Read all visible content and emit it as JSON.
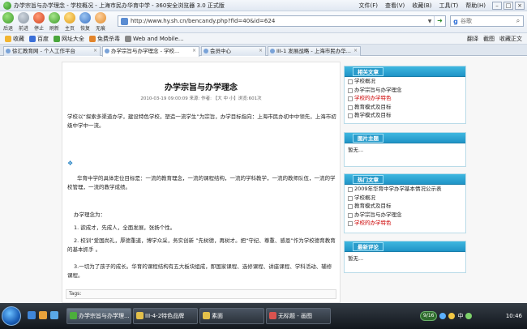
{
  "window": {
    "title": "办学宗旨与办学理念 - 学校概况 - 上海市民办华育中学 - 360安全浏览器 3.0 正式版",
    "menu": [
      "文件(F)",
      "查看(V)",
      "收藏(B)",
      "工具(T)",
      "帮助(H)"
    ]
  },
  "toolbar": {
    "buttons": [
      "后退",
      "前进",
      "停止",
      "刷新",
      "主页",
      "恢复",
      "无痕"
    ],
    "address": "http://www.hy.sh.cn/bencandy.php?fid=40&id=624",
    "search_placeholder": "谷歌"
  },
  "favorites": {
    "items": [
      "收藏",
      "百度",
      "网址大全",
      "免费杀毒",
      "Web and Mobile..."
    ],
    "right_items": [
      "翻译",
      "截图",
      "收藏正文"
    ]
  },
  "tabs": [
    {
      "label": "徐汇教育网 - 个人工作平台"
    },
    {
      "label": "办学宗旨与办学理念 - 学校..."
    },
    {
      "label": "会员中心"
    },
    {
      "label": "III-1 发展战略 - 上海市民办华..."
    }
  ],
  "article": {
    "title": "办学宗旨与办学理念",
    "meta": "2010-03-19 09:00:09 来源: 作者: 【大 中 小】浏览:601次",
    "para1": "学校以“探索多渠道办学，建设特色学校，塑造一流学生”为宗旨，办学目标指向：上海市民办初中中领先，上海市初级中学中一流。",
    "para2": "华育中学的具体定位目标是：一流的教育理念，一流的课程结构，一流的学科教学，一流的教师队伍，一流的学校管理，一流的教学成绩。",
    "para3_title": "办学理念为：",
    "p3_1": "1. 欲成才，先成人，全面发展，张扬个性。",
    "p3_2": "2. 校训“爱国尚礼，厚德重道，博学众采，务实创新 ”先树德，再树才。把“守纪、尊重、感恩”作为学校德育教育的基本抓手 。",
    "p3_3": "3.一切为了孩子的成长。华育的课程结构有五大板块组成，即国家课程、选修课程、讲座课程、学科活动、辅修课程。",
    "tags": "Tags:"
  },
  "sidebar": {
    "related": {
      "title": "相关文章",
      "items": [
        {
          "label": "学校概况",
          "red": false
        },
        {
          "label": "办学宗旨与办学理念",
          "red": false
        },
        {
          "label": "学校的办学特色",
          "red": true
        },
        {
          "label": "教育模式及目标",
          "red": false
        },
        {
          "label": "教学模式及目标",
          "red": false
        }
      ]
    },
    "images": {
      "title": "图片主题",
      "text": "暂无..."
    },
    "hot": {
      "title": "热门文章",
      "items": [
        {
          "label": "2009年华育中学办学基本情况公示表",
          "red": false
        },
        {
          "label": "学校概况",
          "red": false
        },
        {
          "label": "教育模式及目标",
          "red": false
        },
        {
          "label": "办学宗旨与办学理念",
          "red": false
        },
        {
          "label": "学校的办学特色",
          "red": true
        }
      ]
    },
    "comments": {
      "title": "最新评论",
      "text": "暂无..."
    }
  },
  "taskbar": {
    "tasks": [
      "办学宗旨与办学理...",
      "III-4-2特色品牌",
      "素面",
      "无标题 - 画图"
    ],
    "tray_label": "9/16",
    "ime": "中",
    "clock": "10:46"
  }
}
